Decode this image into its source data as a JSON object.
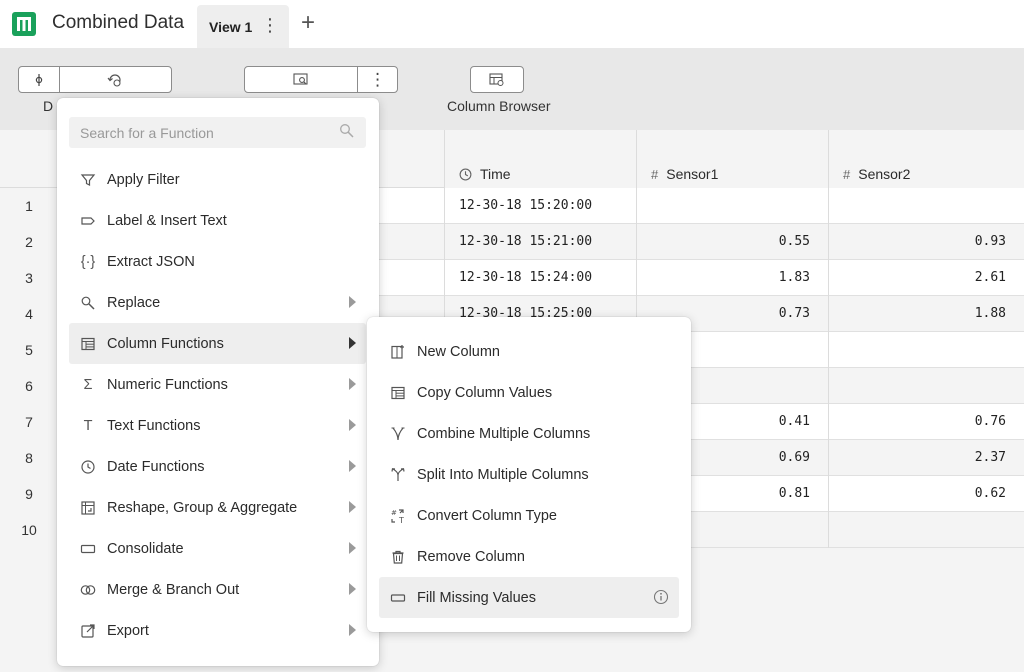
{
  "app": {
    "title": "Combined Data",
    "brand_color": "#1aa15b",
    "tab_label": "View 1",
    "tab_menu_glyph": "⋮",
    "add_tab_glyph": "+"
  },
  "toolbar": {
    "group1_label_fragment": "D",
    "column_browser_label": "Column Browser",
    "more_glyph": "⋮"
  },
  "grid": {
    "columns": [
      {
        "name": "Time",
        "icon": "clock-icon"
      },
      {
        "name": "Sensor1",
        "icon": "hash-icon",
        "icon_glyph": "#"
      },
      {
        "name": "Sensor2",
        "icon": "hash-icon",
        "icon_glyph": "#"
      }
    ],
    "rows": [
      {
        "num": "1",
        "time": "12-30-18 15:20:00",
        "s1": "",
        "s2": ""
      },
      {
        "num": "2",
        "time": "12-30-18 15:21:00",
        "s1": "0.55",
        "s2": "0.93"
      },
      {
        "num": "3",
        "time": "12-30-18 15:24:00",
        "s1": "1.83",
        "s2": "2.61"
      },
      {
        "num": "4",
        "time": "12-30-18 15:25:00",
        "s1": "0.73",
        "s2": "1.88"
      },
      {
        "num": "5",
        "time": "",
        "s1": "",
        "s2": ""
      },
      {
        "num": "6",
        "time": "",
        "s1": "",
        "s2": ""
      },
      {
        "num": "7",
        "time": "",
        "s1": "0.41",
        "s2": "0.76"
      },
      {
        "num": "8",
        "time": "",
        "s1": "0.69",
        "s2": "2.37"
      },
      {
        "num": "9",
        "time": "",
        "s1": "0.81",
        "s2": "0.62"
      },
      {
        "num": "10",
        "time": "",
        "s1": "",
        "s2": ""
      }
    ]
  },
  "menu": {
    "search_placeholder": "Search for a Function",
    "items": [
      {
        "label": "Apply Filter",
        "icon": "filter-icon",
        "has_submenu": false
      },
      {
        "label": "Label & Insert Text",
        "icon": "label-icon",
        "has_submenu": false
      },
      {
        "label": "Extract JSON",
        "icon": "json-icon",
        "icon_glyph": "{·}",
        "has_submenu": false
      },
      {
        "label": "Replace",
        "icon": "replace-icon",
        "has_submenu": true
      },
      {
        "label": "Column Functions",
        "icon": "column-functions-icon",
        "has_submenu": true,
        "active": true
      },
      {
        "label": "Numeric Functions",
        "icon": "sigma-icon",
        "icon_glyph": "Σ",
        "has_submenu": true
      },
      {
        "label": "Text Functions",
        "icon": "text-icon",
        "icon_glyph": "T",
        "has_submenu": true
      },
      {
        "label": "Date Functions",
        "icon": "clock-icon",
        "has_submenu": true
      },
      {
        "label": "Reshape, Group & Aggregate",
        "icon": "reshape-icon",
        "has_submenu": true
      },
      {
        "label": "Consolidate",
        "icon": "consolidate-icon",
        "has_submenu": true
      },
      {
        "label": "Merge & Branch Out",
        "icon": "merge-icon",
        "has_submenu": true
      },
      {
        "label": "Export",
        "icon": "export-icon",
        "has_submenu": true
      }
    ]
  },
  "submenu": {
    "items": [
      {
        "label": "New Column",
        "icon": "new-column-icon"
      },
      {
        "label": "Copy Column Values",
        "icon": "copy-column-icon"
      },
      {
        "label": "Combine Multiple Columns",
        "icon": "combine-icon"
      },
      {
        "label": "Split Into Multiple Columns",
        "icon": "split-icon"
      },
      {
        "label": "Convert Column Type",
        "icon": "convert-type-icon"
      },
      {
        "label": "Remove Column",
        "icon": "trash-icon"
      },
      {
        "label": "Fill Missing Values",
        "icon": "fill-icon",
        "active": true,
        "has_info": true
      }
    ]
  }
}
